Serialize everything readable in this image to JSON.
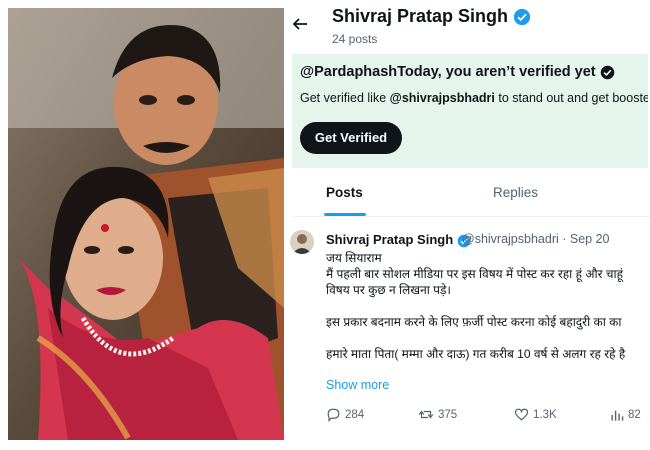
{
  "header": {
    "name": "Shivraj Pratap Singh",
    "posts_count": "24 posts"
  },
  "promo": {
    "title": "@PardaphashToday, you aren’t verified yet",
    "text_prefix": "Get verified like ",
    "text_handle": "@shivrajpsbhadri",
    "text_suffix": " to stand out and get booste",
    "button_label": "Get Verified"
  },
  "tabs": [
    {
      "label": "Posts",
      "active": true
    },
    {
      "label": "Replies",
      "active": false
    }
  ],
  "post": {
    "author_name": "Shivraj Pratap Singh",
    "meta": "@shivrajpsbhadri · Sep 20",
    "lines": [
      "जय सियाराम",
      "मैं पहली बार सोशल मीडिया पर इस विषय में पोस्ट कर रहा हूं और चाहूं",
      "विषय पर कुछ न लिखना पड़े।",
      "",
      "इस प्रकार बदनाम करने के लिए फ़र्जी पोस्ट करना कोई बहादुरी का का",
      "",
      "हमारे माता पिता( मम्मा और दाऊ) गत करीब 10 वर्ष से अलग रह रहे है"
    ],
    "show_more": "Show more",
    "actions": {
      "replies": "284",
      "reposts": "375",
      "likes": "1.3K",
      "views": "82"
    }
  },
  "colors": {
    "accent": "#1d9bf0",
    "promo_bg": "#e6f5ec",
    "text": "#0f1419",
    "muted": "#536471"
  }
}
